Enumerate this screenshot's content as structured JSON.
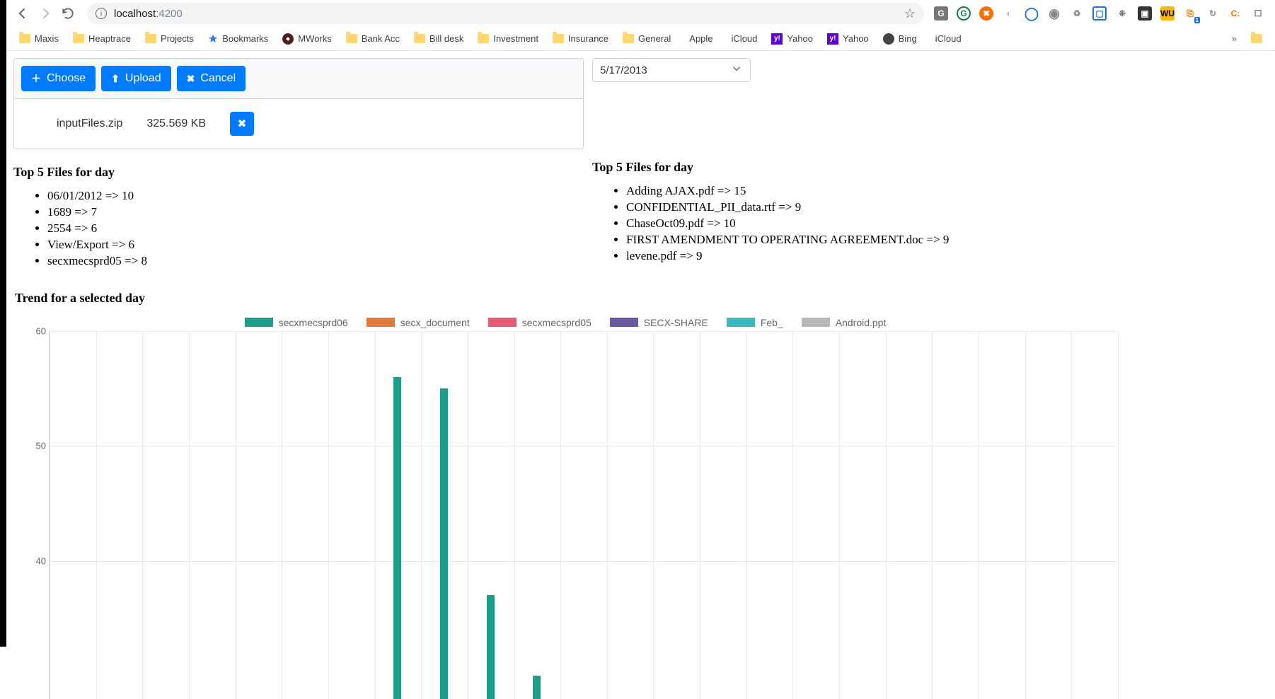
{
  "browser": {
    "url_host": "localhost",
    "url_port": ":4200",
    "extensions": [
      "G",
      "G",
      "X",
      "O",
      "O",
      "O",
      "R",
      "B",
      "C",
      "D",
      "WU",
      "S",
      "G",
      "C",
      "E"
    ],
    "bookmarks": [
      {
        "label": "Maxis",
        "type": "folder"
      },
      {
        "label": "Heaptrace",
        "type": "folder"
      },
      {
        "label": "Projects",
        "type": "folder"
      },
      {
        "label": "Bookmarks",
        "type": "star"
      },
      {
        "label": "MWorks",
        "type": "mworks"
      },
      {
        "label": "Bank Acc",
        "type": "folder"
      },
      {
        "label": "Bill desk",
        "type": "folder"
      },
      {
        "label": "Investment",
        "type": "folder"
      },
      {
        "label": "Insurance",
        "type": "folder"
      },
      {
        "label": "General",
        "type": "folder"
      },
      {
        "label": "Apple",
        "type": "apple"
      },
      {
        "label": "iCloud",
        "type": "apple"
      },
      {
        "label": "Yahoo",
        "type": "yahoo"
      },
      {
        "label": "Yahoo",
        "type": "yahoo"
      },
      {
        "label": "Bing",
        "type": "bing"
      },
      {
        "label": "iCloud",
        "type": "apple"
      }
    ],
    "overflow": "»"
  },
  "uploader": {
    "choose": "Choose",
    "upload": "Upload",
    "cancel": "Cancel",
    "file_name": "inputFiles.zip",
    "file_size": "325.569 KB"
  },
  "date_selected": "5/17/2013",
  "top5_left_heading": "Top 5 Files for day",
  "top5_left": [
    "06/01/2012 => 10",
    "1689 => 7",
    "2554 => 6",
    "View/Export => 6",
    "secxmecsprd05 => 8"
  ],
  "top5_right_heading": "Top 5 Files for day",
  "top5_right": [
    "Adding AJAX.pdf => 15",
    "CONFIDENTIAL_PII_data.rtf => 9",
    "ChaseOct09.pdf => 10",
    "FIRST AMENDMENT TO OPERATING AGREEMENT.doc => 9",
    "levene.pdf => 9"
  ],
  "trend_heading": "Trend for a selected day",
  "chart_data": {
    "type": "bar",
    "ylim": [
      0,
      60
    ],
    "yticks": [
      60,
      50,
      40
    ],
    "x_slots": 23,
    "series": [
      {
        "name": "secxmecsprd06",
        "color": "#1e9e8a",
        "values": {
          "7": 56,
          "8": 55,
          "9": 37,
          "10": 30
        }
      },
      {
        "name": "secx_document",
        "color": "#e07a3c",
        "values": {}
      },
      {
        "name": "secxmecsprd05",
        "color": "#e75a74",
        "values": {}
      },
      {
        "name": "SECX-SHARE",
        "color": "#6a5aa0",
        "values": {}
      },
      {
        "name": "Feb_",
        "color": "#3bb7bd",
        "values": {}
      },
      {
        "name": "Android.ppt",
        "color": "#b8b8b8",
        "values": {}
      }
    ]
  }
}
